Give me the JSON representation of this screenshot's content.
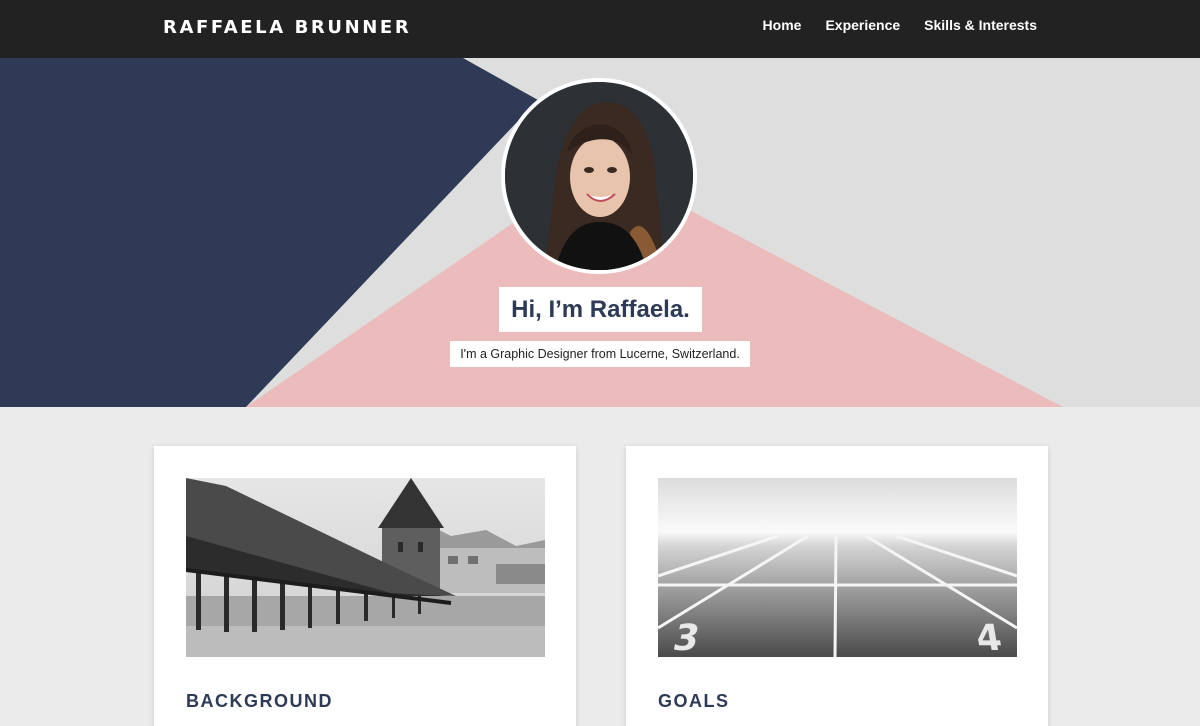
{
  "header": {
    "brand": "RAFFAELA BRUNNER",
    "nav": [
      {
        "label": "Home"
      },
      {
        "label": "Experience"
      },
      {
        "label": "Skills & Interests"
      }
    ]
  },
  "hero": {
    "greeting": "Hi, I’m Raffaela.",
    "tagline": "I'm a Graphic Designer from Lucerne, Switzerland.",
    "colors": {
      "navy": "#2e3a56",
      "pink": "#ebbcbb",
      "gray": "#dedede"
    }
  },
  "cards": [
    {
      "title": "BACKGROUND",
      "image": "lucerne-chapel-bridge-photo"
    },
    {
      "title": "GOALS",
      "image": "running-track-lanes-3-4-photo"
    }
  ]
}
